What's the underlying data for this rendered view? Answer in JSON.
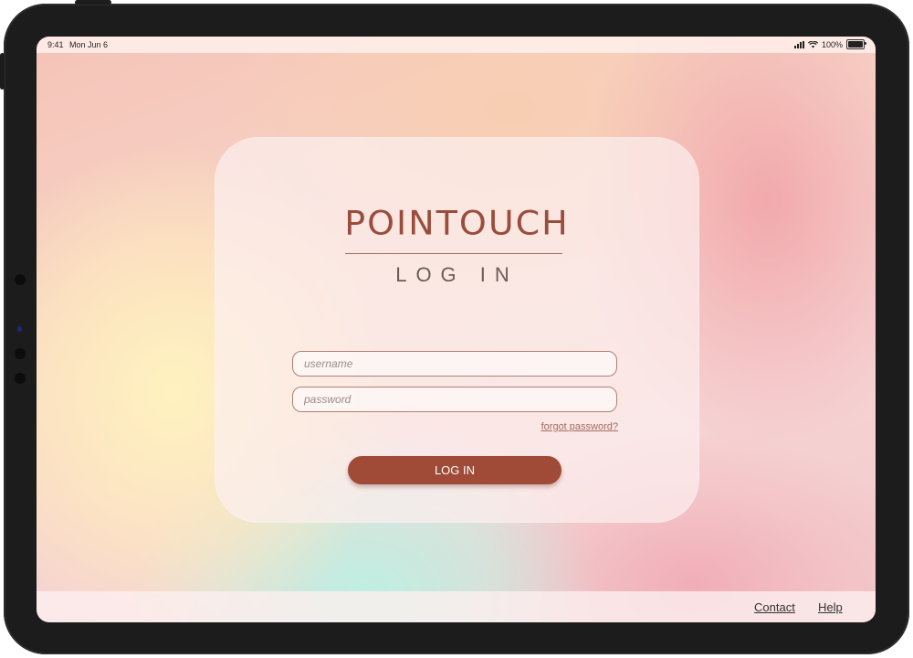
{
  "status_bar": {
    "time": "9:41",
    "date": "Mon Jun 6",
    "battery": "100%",
    "icons": [
      "signal-icon",
      "wifi-icon",
      "battery-icon"
    ]
  },
  "login": {
    "brand": "POINTOUCH",
    "subtitle": "LOG IN",
    "username_placeholder": "username",
    "password_placeholder": "password",
    "forgot_password": "forgot password?",
    "login_button": "LOG IN"
  },
  "footer": {
    "contact": "Contact",
    "help": "Help"
  },
  "colors": {
    "accent": "#a04a38",
    "brand_text": "#9a4d3c",
    "field_border": "#b37f73"
  }
}
